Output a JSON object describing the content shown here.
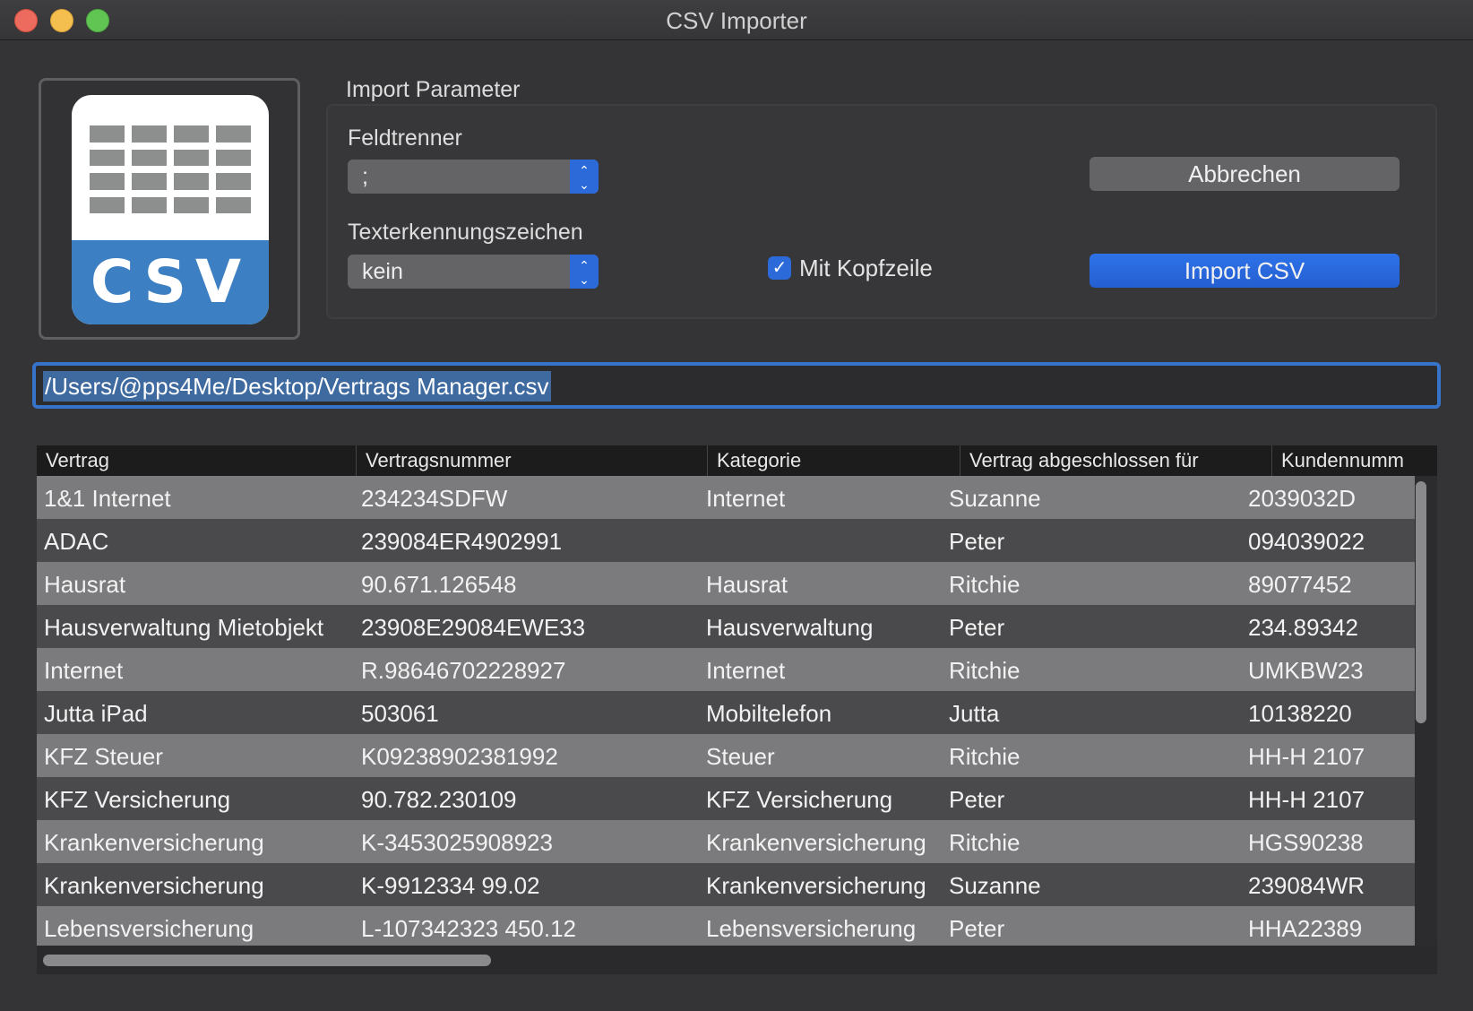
{
  "window": {
    "title": "CSV Importer"
  },
  "icon": {
    "name": "csv-file-icon",
    "badge_text": "CSV"
  },
  "import_parameter": {
    "group_label": "Import Parameter",
    "field_separator": {
      "label": "Feldtrenner",
      "value": ";"
    },
    "text_qualifier": {
      "label": "Texterkennungszeichen",
      "value": "kein"
    },
    "header_row": {
      "label": "Mit Kopfzeile",
      "checked": true
    },
    "cancel_label": "Abbrechen",
    "import_label": "Import CSV"
  },
  "file_path": {
    "value": "/Users/@pps4Me/Desktop/Vertrags Manager.csv"
  },
  "table": {
    "columns": [
      "Vertrag",
      "Vertragsnummer",
      "Kategorie",
      "Vertrag abgeschlossen für",
      "Kundennumm"
    ],
    "rows": [
      [
        "1&1 Internet",
        "234234SDFW",
        "Internet",
        "Suzanne",
        "2039032D"
      ],
      [
        "ADAC",
        "239084ER4902991",
        "",
        "Peter",
        "094039022"
      ],
      [
        "Hausrat",
        "90.671.126548",
        "Hausrat",
        "Ritchie",
        "89077452"
      ],
      [
        "Hausverwaltung Mietobjekt",
        "23908E29084EWE33",
        "Hausverwaltung",
        "Peter",
        "234.89342"
      ],
      [
        "Internet",
        "R.98646702228927",
        "Internet",
        "Ritchie",
        "UMKBW23"
      ],
      [
        "Jutta iPad",
        "503061",
        "Mobiltelefon",
        "Jutta",
        "10138220"
      ],
      [
        "KFZ Steuer",
        "K09238902381992",
        "Steuer",
        "Ritchie",
        "HH-H 2107"
      ],
      [
        "KFZ Versicherung",
        "90.782.230109",
        "KFZ Versicherung",
        "Peter",
        "HH-H 2107"
      ],
      [
        "Krankenversicherung",
        "K-3453025908923",
        "Krankenversicherung",
        "Ritchie",
        "HGS90238"
      ],
      [
        "Krankenversicherung",
        "K-9912334 99.02",
        "Krankenversicherung",
        "Suzanne",
        "239084WR"
      ],
      [
        "Lebensversicherung",
        "L-107342323 450.12",
        "Lebensversicherung",
        "Peter",
        "HHA22389"
      ]
    ]
  },
  "colors": {
    "accent": "#2b6ad8",
    "window_bg": "#343436",
    "row_light": "#7b7b7d",
    "row_dark": "#4a4a4c",
    "csv_blue": "#3c7fc2"
  }
}
